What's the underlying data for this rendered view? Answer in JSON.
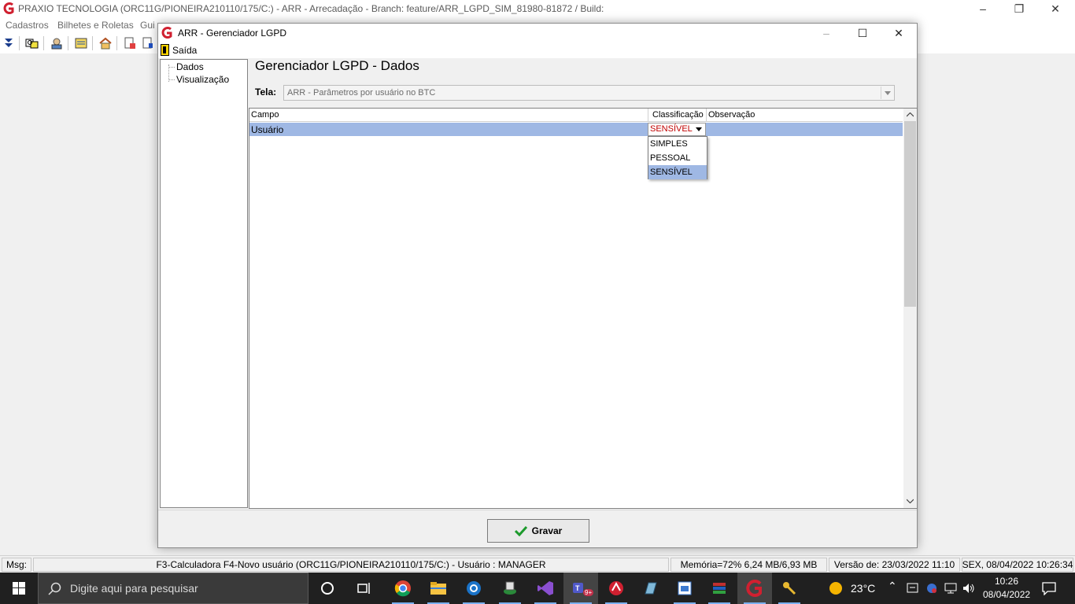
{
  "app": {
    "title": "PRAXIO TECNOLOGIA (ORC11G/PIONEIRA210110/175/C:)  - ARR -  Arrecadação - Branch: feature/ARR_LGPD_SIM_81980-81872 / Build:",
    "menu": [
      "Cadastros",
      "Bilhetes e Roletas",
      "Gui"
    ]
  },
  "dialog": {
    "title": "ARR - Gerenciador LGPD",
    "menu_exit": "Saída",
    "tree": [
      "Dados",
      "Visualização"
    ],
    "page_title": "Gerenciador LGPD - Dados",
    "tela_label": "Tela:",
    "tela_value": "ARR - Parâmetros por usuário no BTC",
    "grid": {
      "columns": [
        "Campo",
        "Classificação",
        "Observação"
      ],
      "rows": [
        {
          "campo": "Usuário",
          "classificacao": "SENSÍVEL",
          "observacao": ""
        }
      ]
    },
    "dropdown_options": [
      "SIMPLES",
      "PESSOAL",
      "SENSÍVEL"
    ],
    "dropdown_selected": "SENSÍVEL",
    "save_label": "Gravar"
  },
  "statusbar": {
    "msg_label": "Msg:",
    "main": "F3-Calculadora F4-Novo usuário (ORC11G/PIONEIRA210110/175/C:)  - Usuário : MANAGER",
    "memory": "Memória=72% 6,24 MB/6,93 MB",
    "version": "Versão de: 23/03/2022 11:10",
    "datetime": "SEX, 08/04/2022 10:26:34"
  },
  "taskbar": {
    "search_placeholder": "Digite aqui para pesquisar",
    "teams_badge": "9+",
    "temperature": "23°C",
    "time": "10:26",
    "date": "08/04/2022"
  },
  "colors": {
    "selection": "#9fb8e4",
    "sensitive_text": "#c00000",
    "brand_red": "#d02030",
    "taskbar": "#202020"
  }
}
